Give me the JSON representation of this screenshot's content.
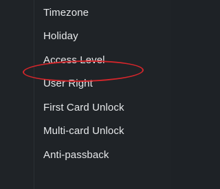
{
  "menu": {
    "items": [
      {
        "label": "Timezone"
      },
      {
        "label": "Holiday"
      },
      {
        "label": "Access Level"
      },
      {
        "label": "User Right"
      },
      {
        "label": "First Card Unlock"
      },
      {
        "label": "Multi-card Unlock"
      },
      {
        "label": "Anti-passback"
      }
    ],
    "highlighted_item": "Access Level"
  },
  "colors": {
    "background": "#1f2327",
    "text": "#e6e8ea",
    "highlight_outline": "#d6262b"
  }
}
